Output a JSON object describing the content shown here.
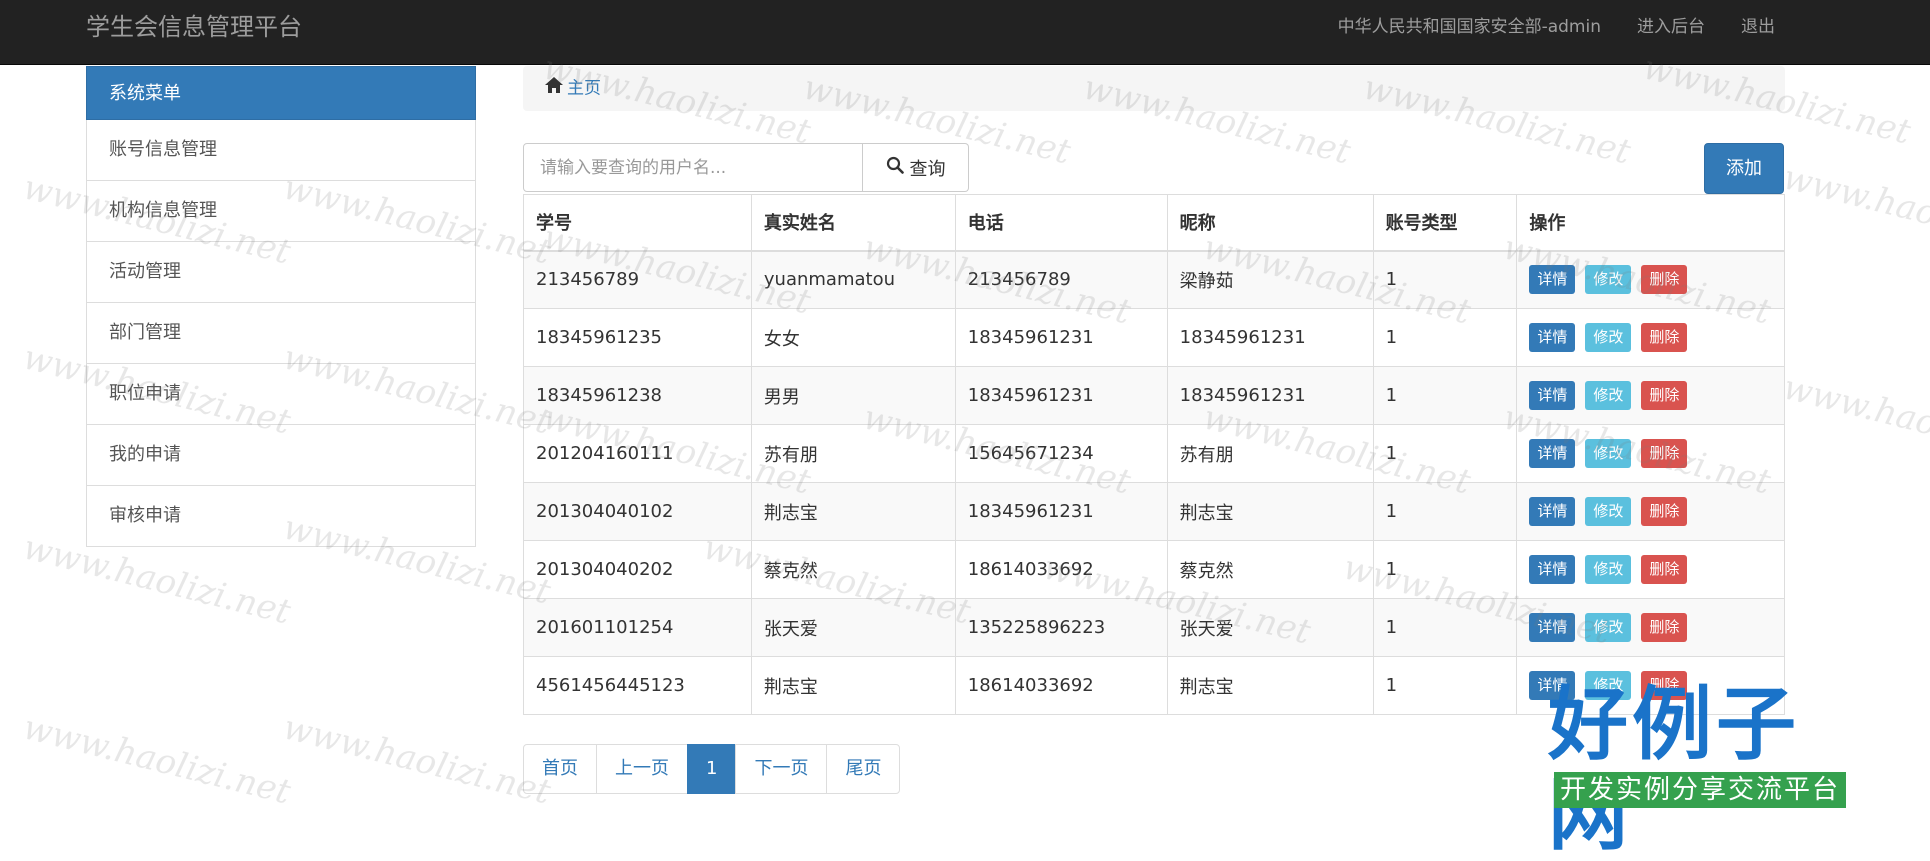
{
  "navbar": {
    "brand": "学生会信息管理平台",
    "links": [
      "中华人民共和国国家安全部-admin",
      "进入后台",
      "退出"
    ]
  },
  "sidebar": {
    "header": "系统菜单",
    "items": [
      "账号信息管理",
      "机构信息管理",
      "活动管理",
      "部门管理",
      "职位申请",
      "我的申请",
      "审核申请"
    ]
  },
  "breadcrumb": {
    "home": "主页"
  },
  "search": {
    "placeholder": "请输入要查询的用户名...",
    "button": "查询"
  },
  "add_button": "添加",
  "table": {
    "headers": [
      "学号",
      "真实姓名",
      "电话",
      "昵称",
      "账号类型",
      "操作"
    ],
    "rows": [
      [
        "213456789",
        "yuanmamatou",
        "213456789",
        "梁静茹",
        "1"
      ],
      [
        "18345961235",
        "女女",
        "18345961231",
        "18345961231",
        "1"
      ],
      [
        "18345961238",
        "男男",
        "18345961231",
        "18345961231",
        "1"
      ],
      [
        "201204160111",
        "苏有朋",
        "15645671234",
        "苏有朋",
        "1"
      ],
      [
        "201304040102",
        "荆志宝",
        "18345961231",
        "荆志宝",
        "1"
      ],
      [
        "201304040202",
        "蔡克然",
        "18614033692",
        "蔡克然",
        "1"
      ],
      [
        "201601101254",
        "张天爱",
        "135225896223",
        "张天爱",
        "1"
      ],
      [
        "4561456445123",
        "荆志宝",
        "18614033692",
        "荆志宝",
        "1"
      ]
    ],
    "actions": {
      "detail": "详情",
      "edit": "修改",
      "delete": "删除"
    }
  },
  "pagination": [
    "首页",
    "上一页",
    "1",
    "下一页",
    "尾页"
  ],
  "watermark": {
    "text": "www.haolizi.net",
    "logo_title": "好例子网",
    "logo_subtitle": "开发实例分享交流平台"
  },
  "colors": {
    "primary": "#337ab7",
    "info": "#5bc0de",
    "danger": "#d9534f",
    "navbar": "#222222"
  }
}
